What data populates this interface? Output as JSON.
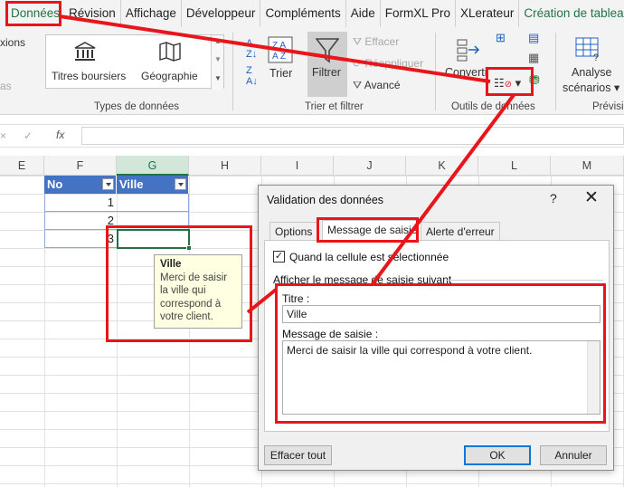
{
  "ribbon_tabs": [
    "Données",
    "Révision",
    "Affichage",
    "Développeur",
    "Compléments",
    "Aide",
    "FormXL Pro",
    "XLerateur",
    "Création de tableau"
  ],
  "ribbon": {
    "left_cut_label": "xions",
    "left_cut_label2": "as",
    "data_types": {
      "stocks": "Titres boursiers",
      "geo": "Géographie",
      "group": "Types de données"
    },
    "sort_filter": {
      "sort": "Trier",
      "filter": "Filtrer",
      "clear": "Effacer",
      "reapply": "Réappliquer",
      "advanced": "Avancé",
      "group": "Trier et filtrer"
    },
    "data_tools": {
      "convert": "Converti",
      "group": "Outils de données"
    },
    "analysis": {
      "label1": "Analyse",
      "label2": "scénarios",
      "group": "Prévisi"
    }
  },
  "formula_bar": {
    "fx": "fx",
    "value": ""
  },
  "columns": [
    "E",
    "F",
    "G",
    "H",
    "I",
    "J",
    "K",
    "L",
    "M"
  ],
  "table": {
    "headers": [
      "No",
      "Ville"
    ],
    "rows": [
      "1",
      "2",
      "3"
    ]
  },
  "tooltip": {
    "title": "Ville",
    "body": "Merci de saisir la ville qui correspond à votre client."
  },
  "dialog": {
    "title": "Validation des données",
    "help": "?",
    "close": "✕",
    "tabs": [
      "Options",
      "Message de saisie",
      "Alerte d'erreur"
    ],
    "checkbox_label": "Quand la cellule est sélectionnée",
    "section_label": "Afficher le message de saisie suivant",
    "title_label": "Titre :",
    "title_value": "Ville",
    "message_label": "Message de saisie :",
    "message_value": "Merci de saisir la ville qui correspond à votre client.",
    "clear_all": "Effacer tout",
    "ok": "OK",
    "cancel": "Annuler"
  },
  "colors": {
    "accent": "#217346",
    "table_header": "#4472c4",
    "annotation": "#e8151b"
  }
}
